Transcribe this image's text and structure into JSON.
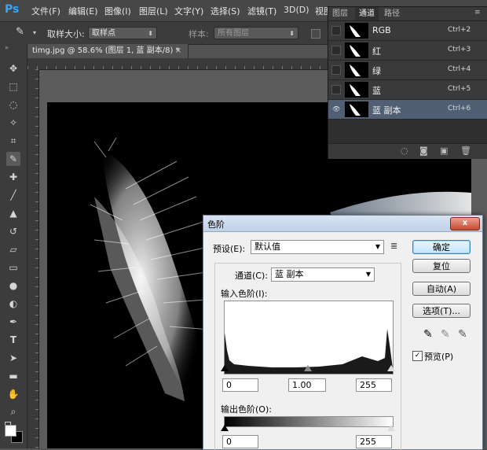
{
  "app": {
    "logo": "Ps"
  },
  "menu": [
    "文件(F)",
    "编辑(E)",
    "图像(I)",
    "图层(L)",
    "文字(Y)",
    "选择(S)",
    "滤镜(T)",
    "3D(D)",
    "视图"
  ],
  "options_bar": {
    "sample_size_label": "取样大小:",
    "sample_size_value": "取样点",
    "sample_label": "样本:",
    "sample_value": "所有图层"
  },
  "document_tab": {
    "title": "timg.jpg @ 58.6% (图层 1, 蓝 副本/8) *",
    "close": "×"
  },
  "channels_panel": {
    "tabs": [
      "图层",
      "通道",
      "路径"
    ],
    "active_tab": 1,
    "channels": [
      {
        "name": "RGB",
        "shortcut": "Ctrl+2",
        "visible": false,
        "active": false
      },
      {
        "name": "红",
        "shortcut": "Ctrl+3",
        "visible": false,
        "active": false
      },
      {
        "name": "绿",
        "shortcut": "Ctrl+4",
        "visible": false,
        "active": false
      },
      {
        "name": "蓝",
        "shortcut": "Ctrl+5",
        "visible": false,
        "active": false
      },
      {
        "name": "蓝 副本",
        "shortcut": "Ctrl+6",
        "visible": true,
        "active": true
      }
    ]
  },
  "levels_dialog": {
    "title": "色阶",
    "close": "x",
    "preset_label": "预设(E):",
    "preset_value": "默认值",
    "channel_label": "通道(C):",
    "channel_value": "蓝 副本",
    "input_label": "输入色阶(I):",
    "input_black": "0",
    "input_gamma": "1.00",
    "input_white": "255",
    "output_label": "输出色阶(O):",
    "output_black": "0",
    "output_white": "255",
    "buttons": {
      "ok": "确定",
      "reset": "复位",
      "auto": "自动(A)",
      "options": "选项(T)..."
    },
    "preview_label": "预览(P)",
    "preview_checked": true
  },
  "colors": {
    "accent": "#31a8ff",
    "active_channel": "#505f74",
    "dialog_bg": "#f0f0f0",
    "close_button": "#c54a32"
  }
}
